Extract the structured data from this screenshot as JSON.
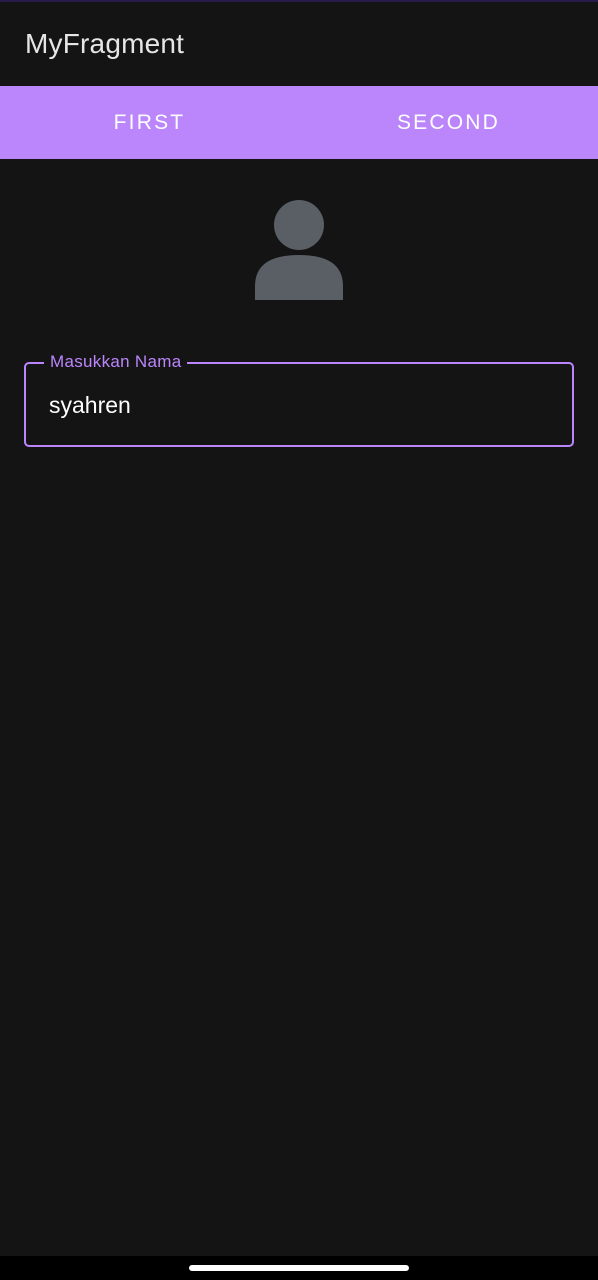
{
  "app": {
    "title": "MyFragment"
  },
  "tabs": [
    {
      "label": "FIRST"
    },
    {
      "label": "SECOND"
    }
  ],
  "profile": {
    "avatar_icon": "person-icon"
  },
  "name_field": {
    "label": "Masukkan Nama",
    "value": "syahren"
  },
  "colors": {
    "accent": "#bb86fc",
    "background": "#141414",
    "avatar": "#5a5f66"
  }
}
